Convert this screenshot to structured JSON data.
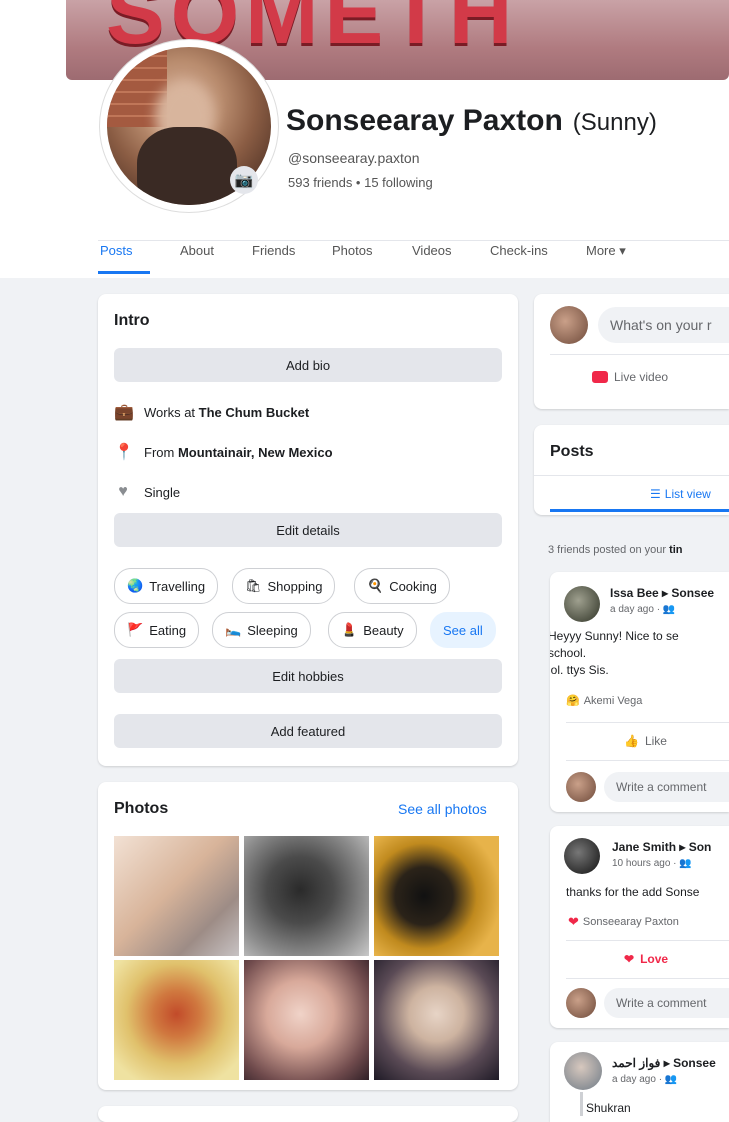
{
  "profile": {
    "cover_text": "SOMETH",
    "name": "Sonseearay Paxton",
    "nickname": "(Sunny)",
    "handle": "@sonseearay.paxton",
    "friends_line": "593 friends • 15 following"
  },
  "tabs": [
    {
      "label": "Posts"
    },
    {
      "label": "About"
    },
    {
      "label": "Friends"
    },
    {
      "label": "Photos"
    },
    {
      "label": "Videos"
    },
    {
      "label": "Check-ins"
    },
    {
      "label": "More ▾"
    }
  ],
  "intro": {
    "title": "Intro",
    "add_bio": "Add bio",
    "works_prefix": "Works at ",
    "works_place": "The Chum Bucket",
    "from_prefix": "From ",
    "from_place": "Mountainair, New Mexico",
    "relationship": "Single",
    "edit_details": "Edit details",
    "hobbies": [
      {
        "label": "Travelling",
        "icon": "🌏"
      },
      {
        "label": "Shopping",
        "icon": "🛍"
      },
      {
        "label": "Cooking",
        "icon": "🍳"
      },
      {
        "label": "Eating",
        "icon": "🚩"
      },
      {
        "label": "Sleeping",
        "icon": "🛌"
      },
      {
        "label": "Beauty",
        "icon": "💄"
      }
    ],
    "see_all": "See all",
    "edit_hobbies": "Edit hobbies",
    "add_featured": "Add featured"
  },
  "photos": {
    "title": "Photos",
    "see_all": "See all photos"
  },
  "composer": {
    "placeholder": "What's on your r",
    "live_video": "Live video"
  },
  "posts_header": {
    "title": "Posts",
    "list_view": "List view"
  },
  "friends_posted": {
    "prefix": "3 friends posted on your ",
    "suffix": "tin"
  },
  "posts": [
    {
      "author": "Issa Bee ▸ Sonsee",
      "time": "a day ago · 👥",
      "text_lines": [
        "Heyyy Sunny!  Nice to se",
        "school.",
        "lol. ttys Sis."
      ],
      "reaction_name": "Akemi Vega",
      "action": "Like",
      "comment_placeholder": "Write a comment"
    },
    {
      "author": "Jane Smith ▸ Son",
      "time": "10 hours ago · 👥",
      "text_lines": [
        "thanks for the add Sonse"
      ],
      "reaction_name": "Sonseearay Paxton",
      "action": "Love",
      "comment_placeholder": "Write a comment"
    },
    {
      "author": "فواز احمد ▸ Sonsee",
      "time": "a day ago · 👥",
      "text_lines": [
        "Shukran"
      ]
    }
  ]
}
